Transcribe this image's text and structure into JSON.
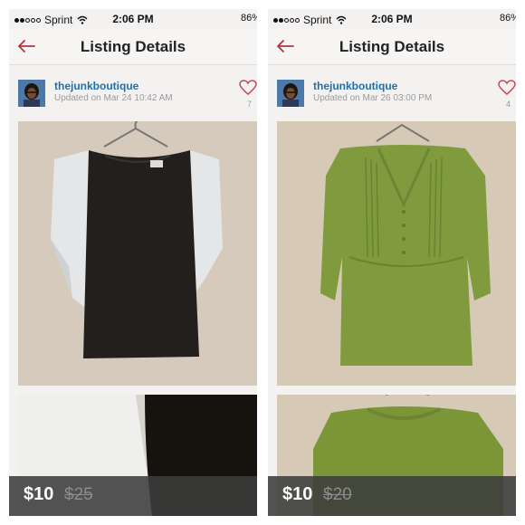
{
  "panels": [
    {
      "status": {
        "carrier": "Sprint",
        "time": "2:06 PM",
        "battery": "86%"
      },
      "nav": {
        "title": "Listing Details"
      },
      "seller": {
        "username": "thejunkboutique",
        "updated": "Updated on Mar 24 10:42 AM",
        "likes": "7"
      },
      "price": {
        "current": "$10",
        "original": "$25"
      },
      "item": {
        "type": "black top with white sleeves",
        "color": "#2a2623"
      }
    },
    {
      "status": {
        "carrier": "Sprint",
        "time": "2:06 PM",
        "battery": "86%"
      },
      "nav": {
        "title": "Listing Details"
      },
      "seller": {
        "username": "thejunkboutique",
        "updated": "Updated on Mar 26 03:00 PM",
        "likes": "4"
      },
      "price": {
        "current": "$10",
        "original": "$20"
      },
      "item": {
        "type": "green pintuck tunic",
        "color": "#7f9b3e"
      }
    }
  ],
  "icons": [
    "wifi-icon",
    "back-arrow-icon",
    "heart-icon",
    "hanger-icon"
  ],
  "colors": {
    "username": "#1f6fa8",
    "back_arrow": "#b2343c",
    "heart": "#c34a54",
    "price_bar": "#3c3c3c"
  }
}
